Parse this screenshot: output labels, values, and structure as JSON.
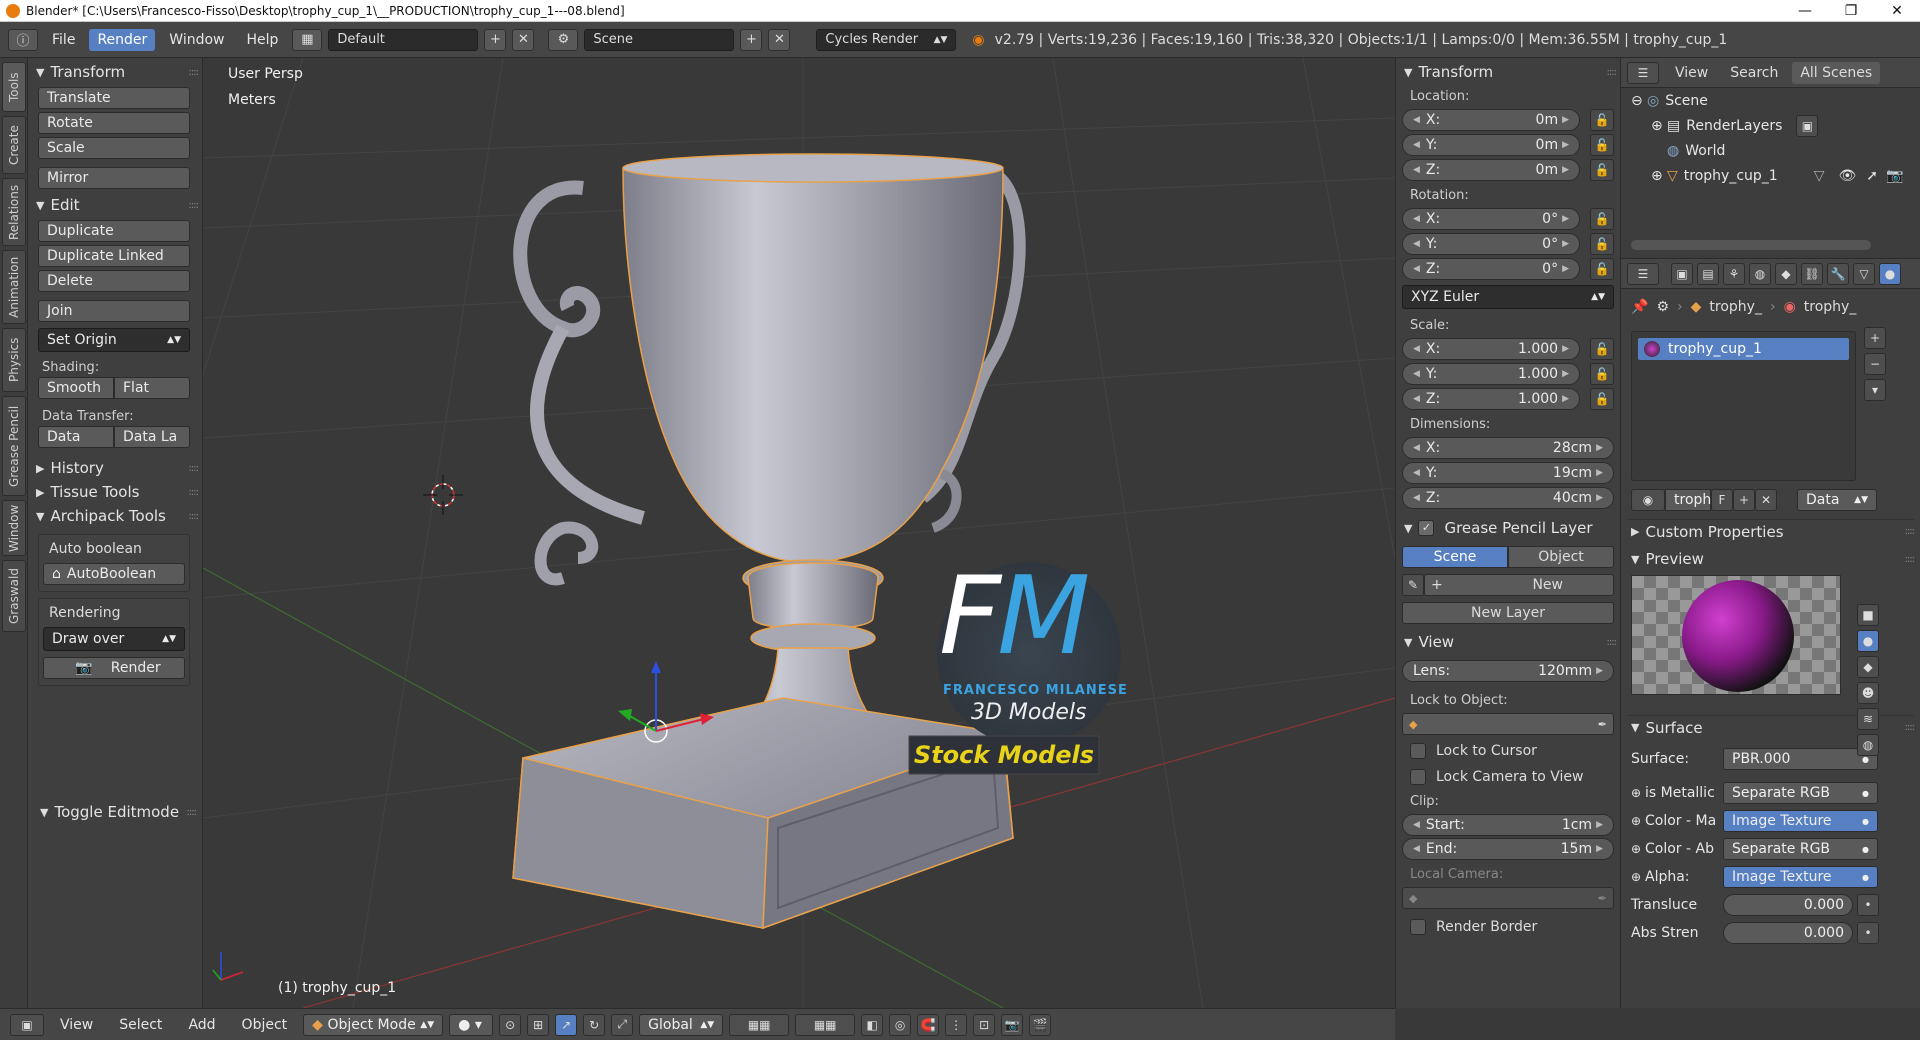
{
  "window": {
    "title": "Blender* [C:\\Users\\Francesco-Fisso\\Desktop\\trophy_cup_1\\__PRODUCTION\\trophy_cup_1---08.blend]",
    "minimize": "—",
    "maximize": "❐",
    "close": "✕"
  },
  "menubar": {
    "menus": [
      "File",
      "Render",
      "Window",
      "Help"
    ],
    "layout": "Default",
    "scene": "Scene",
    "engine": "Cycles Render",
    "stats": "v2.79 | Verts:19,236 | Faces:19,160 | Tris:38,320 | Objects:1/1 | Lamps:0/0 | Mem:36.55M | trophy_cup_1"
  },
  "lefttabs": [
    "Tools",
    "Create",
    "Relations",
    "Animation",
    "Physics",
    "Grease Pencil",
    "Window",
    "Graswald"
  ],
  "toolshelf": {
    "transform_header": "Transform",
    "translate": "Translate",
    "rotate": "Rotate",
    "scale": "Scale",
    "mirror": "Mirror",
    "edit_header": "Edit",
    "duplicate": "Duplicate",
    "duplicate_linked": "Duplicate Linked",
    "delete": "Delete",
    "join": "Join",
    "set_origin": "Set Origin",
    "shading_label": "Shading:",
    "smooth": "Smooth",
    "flat": "Flat",
    "data_transfer_label": "Data Transfer:",
    "data": "Data",
    "data_layout": "Data La",
    "history": "History",
    "tissue_tools": "Tissue Tools",
    "archipack": "Archipack Tools",
    "auto_boolean_label": "Auto boolean",
    "autoboolean_btn": "AutoBoolean",
    "rendering_label": "Rendering",
    "draw_over": "Draw over",
    "render_btn": "Render",
    "toggle_editmode": "Toggle Editmode"
  },
  "viewport": {
    "view_name": "User Persp",
    "units": "Meters",
    "object_label": "(1) trophy_cup_1",
    "logo_letters": "FM",
    "logo_name": "FRANCESCO MILANESE",
    "logo_sub": "3D Models",
    "stock": "Stock Models"
  },
  "npanel": {
    "transform_header": "Transform",
    "location_label": "Location:",
    "location": [
      {
        "axis": "X:",
        "value": "0m"
      },
      {
        "axis": "Y:",
        "value": "0m"
      },
      {
        "axis": "Z:",
        "value": "0m"
      }
    ],
    "rotation_label": "Rotation:",
    "rotation": [
      {
        "axis": "X:",
        "value": "0°"
      },
      {
        "axis": "Y:",
        "value": "0°"
      },
      {
        "axis": "Z:",
        "value": "0°"
      }
    ],
    "rotation_mode": "XYZ Euler",
    "scale_label": "Scale:",
    "scale": [
      {
        "axis": "X:",
        "value": "1.000"
      },
      {
        "axis": "Y:",
        "value": "1.000"
      },
      {
        "axis": "Z:",
        "value": "1.000"
      }
    ],
    "dimensions_label": "Dimensions:",
    "dimensions": [
      {
        "axis": "X:",
        "value": "28cm"
      },
      {
        "axis": "Y:",
        "value": "19cm"
      },
      {
        "axis": "Z:",
        "value": "40cm"
      }
    ],
    "gp_header": "Grease Pencil Layer",
    "gp_scene": "Scene",
    "gp_object": "Object",
    "gp_new": "New",
    "gp_new_layer": "New Layer",
    "view_header": "View",
    "lens_label": "Lens:",
    "lens": "120mm",
    "lock_to_object": "Lock to Object:",
    "lock_to_cursor": "Lock to Cursor",
    "lock_camera": "Lock Camera to View",
    "clip_label": "Clip:",
    "clip_start_label": "Start:",
    "clip_start": "1cm",
    "clip_end_label": "End:",
    "clip_end": "15m",
    "local_camera": "Local Camera:",
    "render_border": "Render Border"
  },
  "outliner": {
    "view": "View",
    "search": "Search",
    "all_scenes": "All Scenes",
    "scene": "Scene",
    "render_layers": "RenderLayers",
    "world": "World",
    "object": "trophy_cup_1"
  },
  "properties": {
    "breadcrumb_1": "trophy_",
    "breadcrumb_2": "trophy_",
    "material_slot": "trophy_cup_1",
    "mat_name": "troph",
    "mat_f": "F",
    "mat_data": "Data",
    "custom_props": "Custom Properties",
    "preview": "Preview",
    "surface_header": "Surface",
    "surface_label": "Surface:",
    "surface_value": "PBR.000",
    "inputs": [
      {
        "label": "is Metallic",
        "value": "Separate RGB"
      },
      {
        "label": "Color - Ma",
        "value": "Image Texture"
      },
      {
        "label": "Color - Ab",
        "value": "Separate RGB"
      },
      {
        "label": "Alpha:",
        "value": "Image Texture"
      }
    ],
    "translucence_label": "Transluce",
    "translucence": "0.000",
    "abs_strength_label": "Abs Stren",
    "abs_strength": "0.000"
  },
  "bottombar": {
    "view": "View",
    "select": "Select",
    "add": "Add",
    "object": "Object",
    "mode": "Object Mode",
    "orientation": "Global"
  },
  "colors": {
    "accent": "#5680c2",
    "logo_blue": "#3aa3e0",
    "logo_yellow": "#e8d21a",
    "selection_outline": "#e8a14a"
  }
}
